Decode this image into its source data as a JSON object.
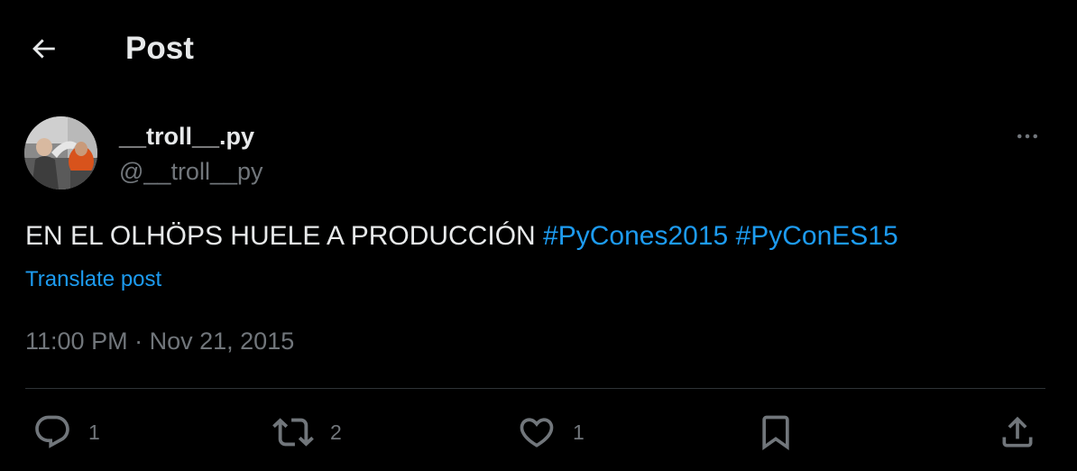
{
  "header": {
    "title": "Post",
    "back_icon": "arrow-left-icon"
  },
  "author": {
    "display_name": "__troll__.py",
    "handle": "@__troll__py",
    "more_icon": "more-horizontal-icon"
  },
  "post": {
    "text": "EN EL OLHÖPS HUELE A PRODUCCIÓN",
    "hashtags": [
      "#PyCones2015",
      "#PyConES15"
    ],
    "translate_label": "Translate post",
    "time": "11:00 PM",
    "separator": "·",
    "date": "Nov 21, 2015"
  },
  "actions": {
    "reply": {
      "icon": "reply-icon",
      "count": "1"
    },
    "repost": {
      "icon": "repost-icon",
      "count": "2"
    },
    "like": {
      "icon": "heart-icon",
      "count": "1"
    },
    "bookmark": {
      "icon": "bookmark-icon"
    },
    "share": {
      "icon": "share-icon"
    }
  },
  "colors": {
    "background": "#000000",
    "text": "#e7e9ea",
    "secondary": "#71767b",
    "accent": "#1d9bf0",
    "divider": "#2f3336"
  }
}
